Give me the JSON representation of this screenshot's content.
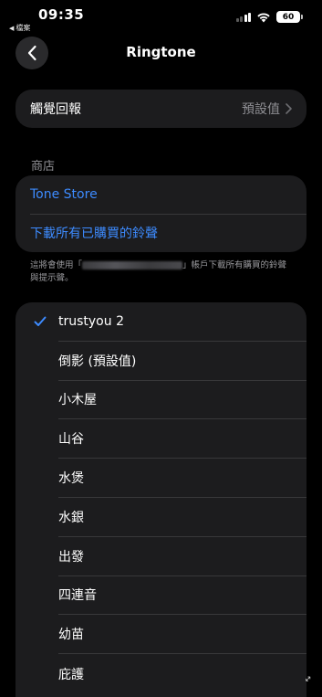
{
  "status": {
    "time": "09:35",
    "back_app": "檔案",
    "battery": "60"
  },
  "nav": {
    "title": "Ringtone"
  },
  "haptics": {
    "label": "觸覺回報",
    "value": "預設值"
  },
  "store_section": {
    "header": "商店",
    "tone_store": "Tone Store",
    "download_all": "下載所有已購買的鈴聲",
    "footnote_before": "這將會使用「",
    "footnote_after": "」帳戶下載所有購買的鈴聲與提示聲。"
  },
  "ringtones": [
    {
      "name": "trustyou 2",
      "selected": true
    },
    {
      "name": "倒影 (預設值)",
      "selected": false
    },
    {
      "name": "小木屋",
      "selected": false
    },
    {
      "name": "山谷",
      "selected": false
    },
    {
      "name": "水煲",
      "selected": false
    },
    {
      "name": "水銀",
      "selected": false
    },
    {
      "name": "出發",
      "selected": false
    },
    {
      "name": "四連音",
      "selected": false
    },
    {
      "name": "幼苗",
      "selected": false
    },
    {
      "name": "庇護",
      "selected": false
    }
  ],
  "colors": {
    "accent": "#3d8bff",
    "background": "#000000",
    "group_background": "#1c1c1e",
    "secondary_text": "#8e8e93"
  }
}
